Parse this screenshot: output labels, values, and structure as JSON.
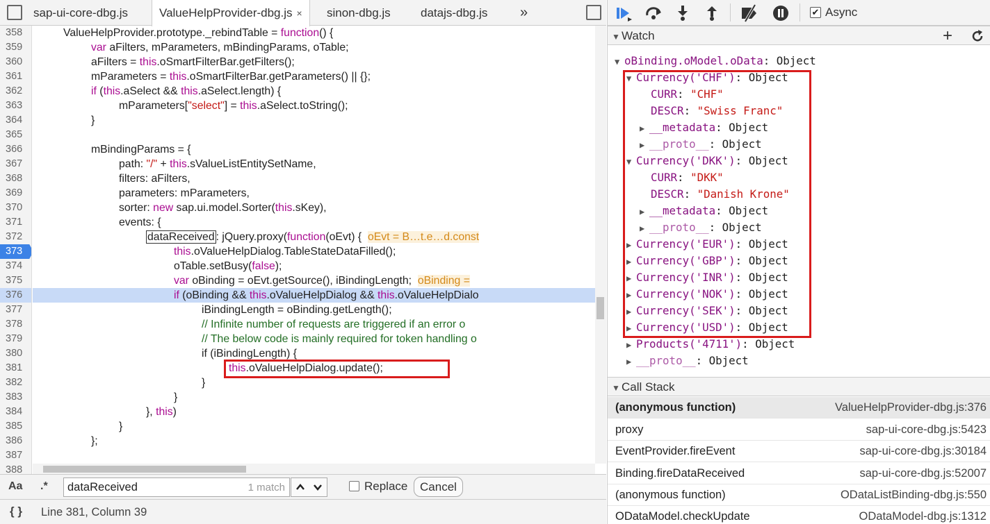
{
  "editor": {
    "tabs": [
      {
        "label": "sap-ui-core-dbg.js"
      },
      {
        "label": "ValueHelpProvider-dbg.js",
        "close": "×"
      },
      {
        "label": "sinon-dbg.js"
      },
      {
        "label": "datajs-dbg.js"
      }
    ],
    "tabs_overflow": "»",
    "line_numbers": [
      "358",
      "359",
      "360",
      "361",
      "362",
      "363",
      "364",
      "365",
      "366",
      "367",
      "368",
      "369",
      "370",
      "371",
      "372",
      "373",
      "374",
      "375",
      "376",
      "377",
      "378",
      "379",
      "380",
      "381",
      "382",
      "383",
      "384",
      "385",
      "386",
      "387",
      "388"
    ],
    "breakpoint_line": "373",
    "current_line": "376",
    "code": {
      "l358a": "ValueHelpProvider.prototype._rebindTable = ",
      "l358b": "function",
      "l358c": "() {",
      "l359a": "var",
      "l359b": " aFilters, mParameters, mBindingParams, oTable;",
      "l360a": "aFilters = ",
      "l360b": "this",
      "l360c": ".oSmartFilterBar.getFilters();",
      "l361a": "mParameters = ",
      "l361b": "this",
      "l361c": ".oSmartFilterBar.getParameters() || {};",
      "l362a": "if",
      "l362b": " (",
      "l362c": "this",
      "l362d": ".aSelect && ",
      "l362e": "this",
      "l362f": ".aSelect.length) {",
      "l363a": "mParameters[",
      "l363b": "\"select\"",
      "l363c": "] = ",
      "l363d": "this",
      "l363e": ".aSelect.toString();",
      "l364": "}",
      "l366": "mBindingParams = {",
      "l367a": "path: ",
      "l367b": "\"/\"",
      "l367c": " + ",
      "l367d": "this",
      "l367e": ".sValueListEntitySetName,",
      "l368": "filters: aFilters,",
      "l369": "parameters: mParameters,",
      "l370a": "sorter: ",
      "l370b": "new",
      "l370c": " sap.ui.model.Sorter(",
      "l370d": "this",
      "l370e": ".sKey),",
      "l371": "events: {",
      "l372a": "dataReceived",
      "l372b": ": jQuery.proxy(",
      "l372c": "function",
      "l372d": "(oEvt) {",
      "l372e": "oEvt = B…t.e…d.const",
      "l373a": "this",
      "l373b": ".oValueHelpDialog.TableStateDataFilled();",
      "l374a": "oTable.setBusy(",
      "l374b": "false",
      "l374c": ");",
      "l375a": "var",
      "l375b": " oBinding = oEvt.getSource(), iBindingLength;",
      "l375c": "oBinding =",
      "l376a": "if",
      "l376b": " (oBinding && ",
      "l376c": "this",
      "l376d": ".oValueHelpDialog && ",
      "l376e": "this",
      "l376f": ".oValueHelpDialo",
      "l377": "iBindingLength = oBinding.getLength();",
      "l378": "// Infinite number of requests are triggered if an error o",
      "l379": "// The below code is mainly required for token handling o",
      "l380": "if (iBindingLength) {",
      "l381a": "this",
      "l381b": ".oValueHelpDialog.update();",
      "l382": "}",
      "l383": "}",
      "l384a": "}, ",
      "l384b": "this",
      "l384c": ")",
      "l385": "}",
      "l386": "};"
    }
  },
  "search": {
    "case_label": "Aa",
    "regex_label": ".*",
    "value": "dataReceived",
    "match_count": "1 match",
    "replace_label": "Replace",
    "cancel_label": "Cancel"
  },
  "status": {
    "braces": "{ }",
    "position": "Line 381, Column 39"
  },
  "debugger": {
    "async_label": "Async",
    "watch": {
      "title": "Watch",
      "add": "+",
      "root_key": "oBinding.oModel.oData",
      "root_val": ": Object",
      "chf_key": "Currency('CHF')",
      "chf_curr_key": "CURR",
      "chf_curr_val": "\"CHF\"",
      "chf_descr_key": "DESCR",
      "chf_descr_val": "\"Swiss Franc\"",
      "meta_key": "__metadata",
      "proto_key": "__proto__",
      "obj": ": Object",
      "colon": ": ",
      "dkk_key": "Currency('DKK')",
      "dkk_curr_val": "\"DKK\"",
      "dkk_descr_val": "\"Danish Krone\"",
      "eur_key": "Currency('EUR')",
      "gbp_key": "Currency('GBP')",
      "inr_key": "Currency('INR')",
      "nok_key": "Currency('NOK')",
      "sek_key": "Currency('SEK')",
      "usd_key": "Currency('USD')",
      "products_key": "Products('4711')"
    },
    "callstack": {
      "title": "Call Stack",
      "frames": [
        {
          "fn": "(anonymous function)",
          "loc": "ValueHelpProvider-dbg.js:376"
        },
        {
          "fn": "proxy",
          "loc": "sap-ui-core-dbg.js:5423"
        },
        {
          "fn": "EventProvider.fireEvent",
          "loc": "sap-ui-core-dbg.js:30184"
        },
        {
          "fn": "Binding.fireDataReceived",
          "loc": "sap-ui-core-dbg.js:52007"
        },
        {
          "fn": "(anonymous function)",
          "loc": "ODataListBinding-dbg.js:550"
        },
        {
          "fn": "ODataModel.checkUpdate",
          "loc": "ODataModel-dbg.js:1312"
        }
      ]
    }
  },
  "colors": {
    "accent": "#3c82e6",
    "highlight": "#c8daf7",
    "keyword": "#aa0d91",
    "string": "#c41a16",
    "comment": "#236e25",
    "annotation": "#d91c1c"
  }
}
